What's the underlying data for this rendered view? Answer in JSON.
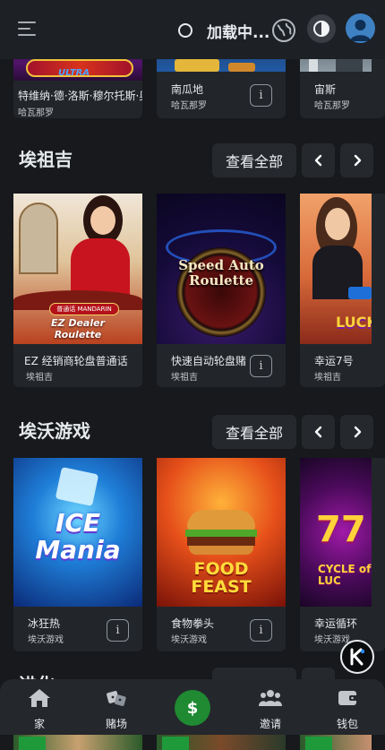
{
  "header": {
    "loading_text": "加载中...",
    "menu_icon": "menu-icon",
    "globe_icon": "globe-icon",
    "theme_icon": "theme-toggle-icon",
    "avatar_icon": "user-avatar-icon"
  },
  "top_row": [
    {
      "title": "特维纳·德·洛斯·穆尔托斯·奥特",
      "provider": "哈瓦那罗"
    },
    {
      "title": "南瓜地",
      "provider": "哈瓦那罗"
    },
    {
      "title": "宙斯",
      "provider": "哈瓦那罗"
    }
  ],
  "sections": [
    {
      "title": "埃祖吉",
      "view_all": "查看全部",
      "games": [
        {
          "title": "EZ 经销商轮盘普通话",
          "provider": "埃祖吉",
          "art": "EZ Dealer Roulette",
          "badge": "普通话 MANDARIN"
        },
        {
          "title": "快速自动轮盘赌",
          "provider": "埃祖吉",
          "art": "Speed Auto Roulette"
        },
        {
          "title": "幸运7号",
          "provider": "埃祖吉",
          "art": "LUCK"
        }
      ]
    },
    {
      "title": "埃沃游戏",
      "view_all": "查看全部",
      "games": [
        {
          "title": "冰狂热",
          "provider": "埃沃游戏",
          "art": "ICE Mania"
        },
        {
          "title": "食物拳头",
          "provider": "埃沃游戏",
          "art": "FOOD FEAST"
        },
        {
          "title": "幸运循环",
          "provider": "埃沃游戏",
          "art": "CYCLE of LUC"
        }
      ]
    },
    {
      "title": "进化"
    }
  ],
  "bottom_nav": [
    {
      "label": "家",
      "icon": "home-icon"
    },
    {
      "label": "赌场",
      "icon": "dice-icon"
    },
    {
      "label": "",
      "icon": "dollar-icon"
    },
    {
      "label": "邀请",
      "icon": "users-icon"
    },
    {
      "label": "钱包",
      "icon": "wallet-icon"
    }
  ],
  "colors": {
    "background": "#17191c",
    "card": "#22262a",
    "button": "#25292e",
    "accent_green": "#1f8a32"
  }
}
